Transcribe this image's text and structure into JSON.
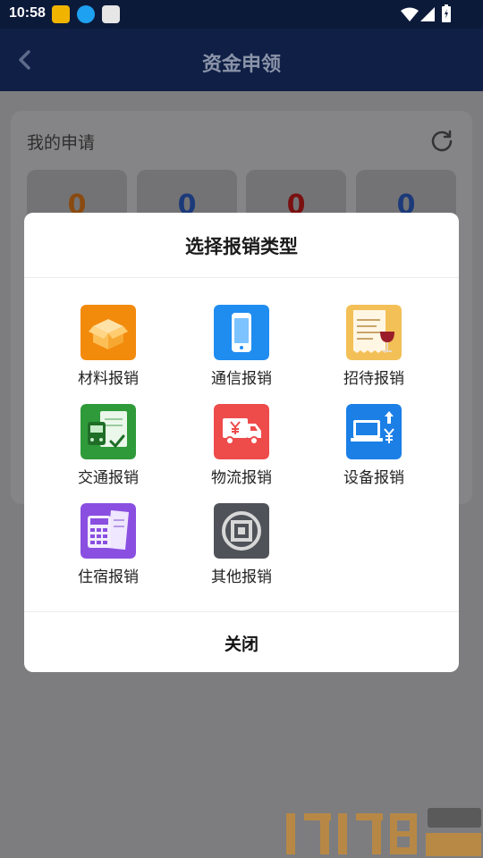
{
  "status_bar": {
    "time": "10:58"
  },
  "app_bar": {
    "title": "资金申领"
  },
  "background": {
    "card_title": "我的申请",
    "stats": [
      {
        "value": "0",
        "color": "#8a4a10"
      },
      {
        "value": "0",
        "color": "#1c3a7a"
      },
      {
        "value": "0",
        "color": "#7a1010"
      },
      {
        "value": "0",
        "color": "#1c3a7a"
      }
    ]
  },
  "modal": {
    "title": "选择报销类型",
    "close_label": "关闭",
    "options": [
      {
        "label": "材料报销",
        "icon": "box-icon"
      },
      {
        "label": "通信报销",
        "icon": "phone-icon"
      },
      {
        "label": "招待报销",
        "icon": "receipt-wine-icon"
      },
      {
        "label": "交通报销",
        "icon": "bus-icon"
      },
      {
        "label": "物流报销",
        "icon": "truck-icon"
      },
      {
        "label": "设备报销",
        "icon": "laptop-icon"
      },
      {
        "label": "住宿报销",
        "icon": "calculator-icon"
      },
      {
        "label": "其他报销",
        "icon": "square-icon"
      }
    ]
  },
  "colors": {
    "app_bar": "#0f1f45",
    "overlay": "#7d7d7f",
    "modal": "#ffffff"
  }
}
